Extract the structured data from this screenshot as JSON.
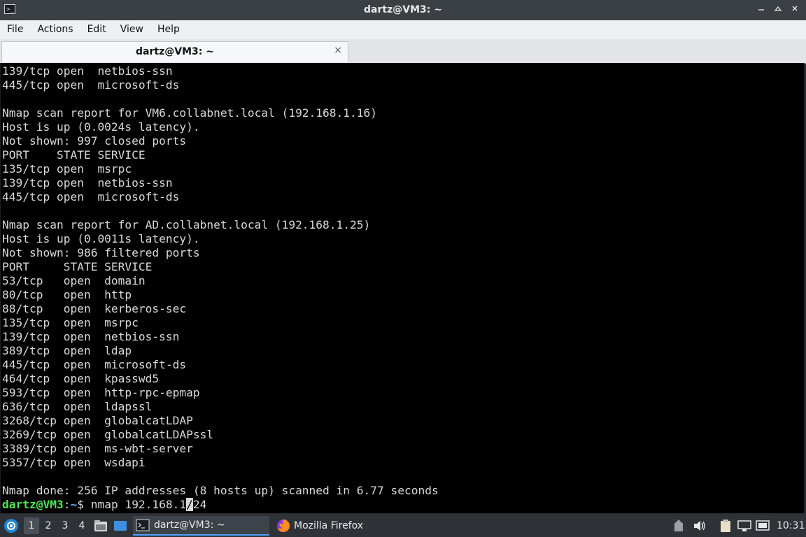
{
  "window": {
    "title": "dartz@VM3: ~",
    "controls": [
      "minimize-icon",
      "maximize-icon",
      "close-icon"
    ]
  },
  "menu": [
    "File",
    "Actions",
    "Edit",
    "View",
    "Help"
  ],
  "tab": {
    "label": "dartz@VM3: ~",
    "close": "×"
  },
  "terminal": {
    "lines": [
      "139/tcp open  netbios-ssn",
      "445/tcp open  microsoft-ds",
      "",
      "Nmap scan report for VM6.collabnet.local (192.168.1.16)",
      "Host is up (0.0024s latency).",
      "Not shown: 997 closed ports",
      "PORT    STATE SERVICE",
      "135/tcp open  msrpc",
      "139/tcp open  netbios-ssn",
      "445/tcp open  microsoft-ds",
      "",
      "Nmap scan report for AD.collabnet.local (192.168.1.25)",
      "Host is up (0.0011s latency).",
      "Not shown: 986 filtered ports",
      "PORT     STATE SERVICE",
      "53/tcp   open  domain",
      "80/tcp   open  http",
      "88/tcp   open  kerberos-sec",
      "135/tcp  open  msrpc",
      "139/tcp  open  netbios-ssn",
      "389/tcp  open  ldap",
      "445/tcp  open  microsoft-ds",
      "464/tcp  open  kpasswd5",
      "593/tcp  open  http-rpc-epmap",
      "636/tcp  open  ldapssl",
      "3268/tcp open  globalcatLDAP",
      "3269/tcp open  globalcatLDAPssl",
      "3389/tcp open  ms-wbt-server",
      "5357/tcp open  wsdapi",
      "",
      "Nmap done: 256 IP addresses (8 hosts up) scanned in 6.77 seconds"
    ],
    "prompt": {
      "user_host": "dartz@VM3",
      "separator": ":",
      "path": "~",
      "symbol": "$",
      "command_before_cursor": " nmap 192.168.1",
      "cursor_char": "/",
      "command_after_cursor": "24"
    },
    "colors": {
      "background": "#000000",
      "text": "#d8d8d8",
      "user": "#4ee44e",
      "path": "#6fa8ff"
    }
  },
  "taskbar": {
    "workspaces": [
      "1",
      "2",
      "3",
      "4"
    ],
    "active_workspace": "1",
    "tasks": [
      {
        "label": "dartz@VM3: ~",
        "icon": "terminal-icon",
        "active": true
      },
      {
        "label": "Mozilla Firefox",
        "icon": "firefox-icon",
        "active": false
      }
    ],
    "clock": "10:31"
  }
}
